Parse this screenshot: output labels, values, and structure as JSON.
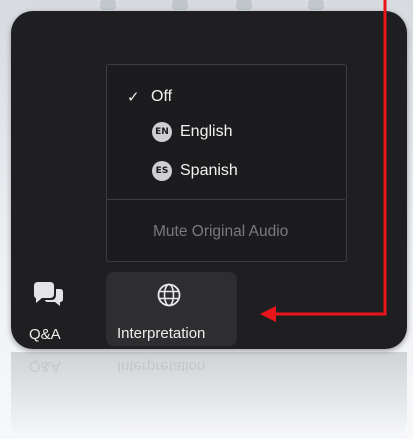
{
  "menu": {
    "items": [
      {
        "label": "Off",
        "checked": true
      },
      {
        "label": "English",
        "badge": "EN"
      },
      {
        "label": "Spanish",
        "badge": "ES"
      }
    ],
    "mute_label": "Mute Original Audio"
  },
  "toolbar": {
    "qa_label": "Q&A",
    "interpretation_label": "Interpretation"
  },
  "icons": {
    "check": "check-icon",
    "qa": "chat-bubbles-icon",
    "interpretation": "globe-icon"
  },
  "colors": {
    "panel_bg": "#1f1f21",
    "menu_bg": "#1c1c1e",
    "button_bg": "#2e2e31",
    "text": "#ededed",
    "disabled_text": "#7a7a7d",
    "annotation": "#e8151b"
  }
}
